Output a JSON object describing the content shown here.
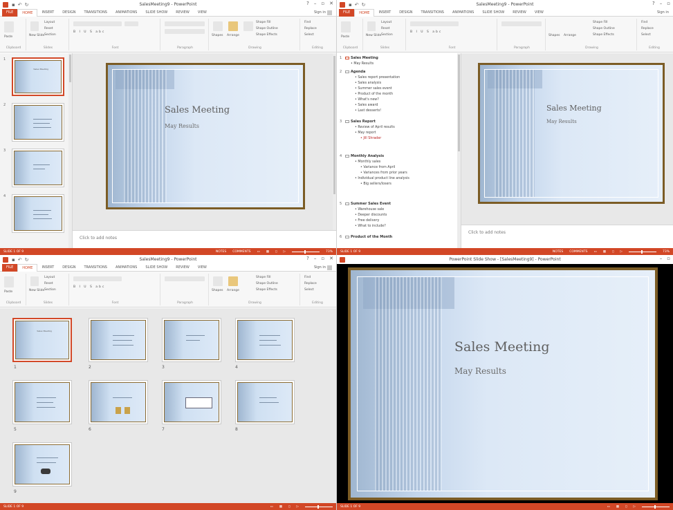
{
  "app": {
    "title_normal": "SalesMeeting9 - PowerPoint",
    "title_show": "PowerPoint Slide Show - [SalesMeeting9] - PowerPoint",
    "sign_in": "Sign in",
    "file_tab": "FILE",
    "tabs": [
      "HOME",
      "INSERT",
      "DESIGN",
      "TRANSITIONS",
      "ANIMATIONS",
      "SLIDE SHOW",
      "REVIEW",
      "VIEW"
    ]
  },
  "ribbon": {
    "paste": "Paste",
    "clipboard": "Clipboard",
    "new_slide": "New Slide",
    "layout": "Layout",
    "reset": "Reset",
    "section": "Section",
    "slides": "Slides",
    "font": "Font",
    "paragraph": "Paragraph",
    "shapes": "Shapes",
    "arrange": "Arrange",
    "quick_styles": "Quick Styles",
    "shape_fill": "Shape Fill",
    "shape_outline": "Shape Outline",
    "shape_effects": "Shape Effects",
    "drawing": "Drawing",
    "find": "Find",
    "replace": "Replace",
    "select": "Select",
    "editing": "Editing"
  },
  "slide": {
    "title": "Sales Meeting",
    "subtitle": "May Results"
  },
  "notes_placeholder": "Click to add notes",
  "status": {
    "slide_of": "SLIDE 1 OF 9",
    "notes": "NOTES",
    "comments": "COMMENTS",
    "zoom": "73%"
  },
  "outline": [
    {
      "num": "1",
      "title": "Sales Meeting",
      "bullets": [
        "May Results"
      ]
    },
    {
      "num": "2",
      "title": "Agenda",
      "bullets": [
        "Sales report presentation",
        "Sales analysis",
        "Summer sales event",
        "Product of the month",
        "What's new?",
        "Sales award",
        "Last desserts!"
      ]
    },
    {
      "num": "3",
      "title": "Sales Report",
      "bullets": [
        "Review of April results",
        "May report",
        "Jill Shrader"
      ]
    },
    {
      "num": "4",
      "title": "Monthly Analysis",
      "bullets": [
        "Monthly sales",
        "Variance from April",
        "Variances from prior years",
        "Individual product line analysis",
        "Big sellers/losers"
      ]
    },
    {
      "num": "5",
      "title": "Summer Sales Event",
      "bullets": [
        "Warehouse sale",
        "Deeper discounts",
        "Free delivery",
        "What to include?"
      ]
    },
    {
      "num": "6",
      "title": "Product of the Month",
      "bullets": []
    }
  ],
  "thumb_numbers": [
    "1",
    "2",
    "3",
    "4"
  ],
  "sorter_numbers": [
    "1",
    "2",
    "3",
    "4",
    "5",
    "6",
    "7",
    "8",
    "9"
  ],
  "colors": {
    "accent": "#d24726",
    "frame": "#7b5c25"
  }
}
